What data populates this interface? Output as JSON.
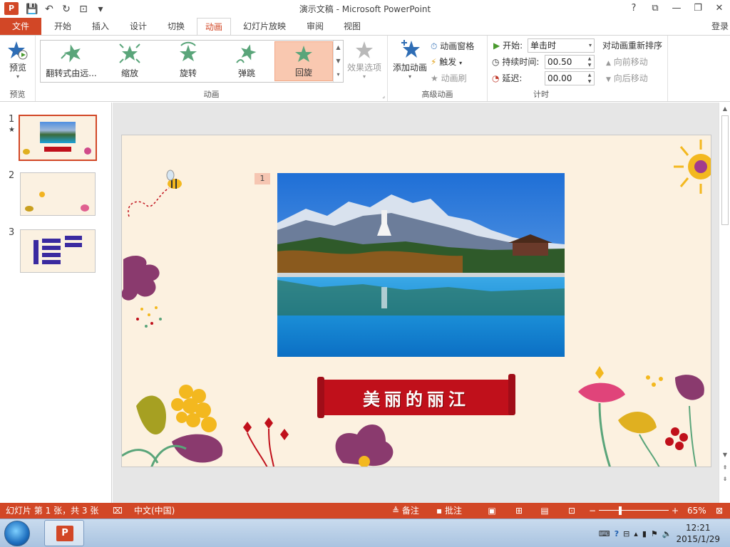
{
  "window": {
    "title": "演示文稿 - Microsoft PowerPoint",
    "app_icon": "P",
    "controls": [
      "?",
      "⧉",
      "—",
      "❐",
      "✕"
    ]
  },
  "qat": {
    "save": "💾",
    "undo": "↶",
    "redo": "↻",
    "present": "⊡",
    "more": "▾"
  },
  "tabs": {
    "file": "文件",
    "items": [
      "开始",
      "插入",
      "设计",
      "切换",
      "动画",
      "幻灯片放映",
      "审阅",
      "视图"
    ],
    "active": "动画",
    "login": "登录"
  },
  "ribbon": {
    "preview": {
      "label": "预览",
      "group": "预览"
    },
    "animation_group": "动画",
    "gallery": [
      {
        "label": "翻转式由远...",
        "selected": false
      },
      {
        "label": "缩放",
        "selected": false
      },
      {
        "label": "旋转",
        "selected": false
      },
      {
        "label": "弹跳",
        "selected": false
      },
      {
        "label": "回旋",
        "selected": true
      }
    ],
    "effect_options": "效果选项",
    "advanced": {
      "group": "高级动画",
      "add_animation": "添加动画",
      "animation_pane": "动画窗格",
      "trigger": "触发",
      "painter": "动画刷"
    },
    "timing": {
      "group": "计时",
      "start_label": "开始:",
      "start_value": "单击时",
      "duration_label": "持续时间:",
      "duration_value": "00.50",
      "delay_label": "延迟:",
      "delay_value": "00.00",
      "reorder_title": "对动画重新排序",
      "move_earlier": "向前移动",
      "move_later": "向后移动"
    }
  },
  "slides": [
    {
      "num": "1",
      "star": "★"
    },
    {
      "num": "2"
    },
    {
      "num": "3"
    }
  ],
  "slide": {
    "anim_tag": "1",
    "banner_text": "美丽的丽江"
  },
  "status": {
    "slide_info": "幻灯片 第 1 张，共 3 张",
    "language": "中文(中国)",
    "notes": "备注",
    "comments": "批注",
    "zoom": "65%",
    "zoom_fraction": 0.65
  },
  "taskbar": {
    "time": "12:21",
    "date": "2015/1/29"
  },
  "colors": {
    "accent": "#d24726",
    "slide_bg": "#fcf1e0",
    "banner": "#c0101b"
  }
}
